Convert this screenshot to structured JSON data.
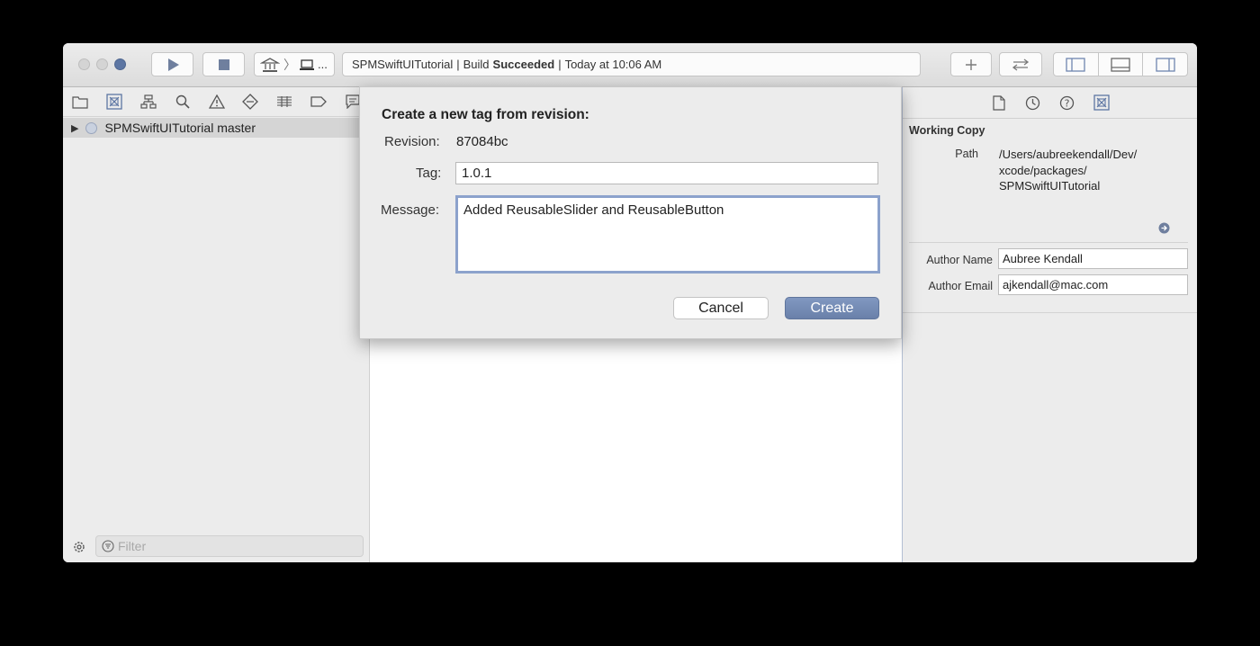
{
  "toolbar": {
    "scheme_label": "...",
    "status": {
      "project": "SPMSwiftUITutorial",
      "sep1": "|",
      "build_prefix": "Build",
      "build_state": "Succeeded",
      "sep2": "|",
      "time": "Today at 10:06 AM"
    },
    "add_icon": "plus-icon",
    "swap_icon": "swap-icon"
  },
  "navigator": {
    "icons": [
      "folder-icon",
      "source-control-icon",
      "hierarchy-icon",
      "search-icon",
      "warning-icon",
      "test-icon",
      "debug-icon",
      "breakpoint-icon",
      "report-icon"
    ],
    "tree": {
      "label": "SPMSwiftUITutorial master"
    },
    "filter_placeholder": "Filter"
  },
  "dialog": {
    "title": "Create a new tag from revision:",
    "revision_label": "Revision:",
    "revision_value": "87084bc",
    "tag_label": "Tag:",
    "tag_value": "1.0.1",
    "message_label": "Message:",
    "message_value": "Added ReusableSlider and ReusableButton",
    "cancel_label": "Cancel",
    "create_label": "Create"
  },
  "inspector": {
    "tabs": [
      "file-icon",
      "history-icon",
      "help-icon",
      "source-control-icon"
    ],
    "section_title": "Working Copy",
    "path_label": "Path",
    "path_lines": [
      "/Users/aubreekendall/Dev/",
      "xcode/packages/",
      "SPMSwiftUITutorial"
    ],
    "author_name_label": "Author Name",
    "author_name_value": "Aubree Kendall",
    "author_email_label": "Author Email",
    "author_email_value": "ajkendall@mac.com"
  },
  "colors": {
    "accent": "#6f86b0",
    "create_button": "#6f86b0",
    "focus_ring": "#8ca2cc"
  }
}
